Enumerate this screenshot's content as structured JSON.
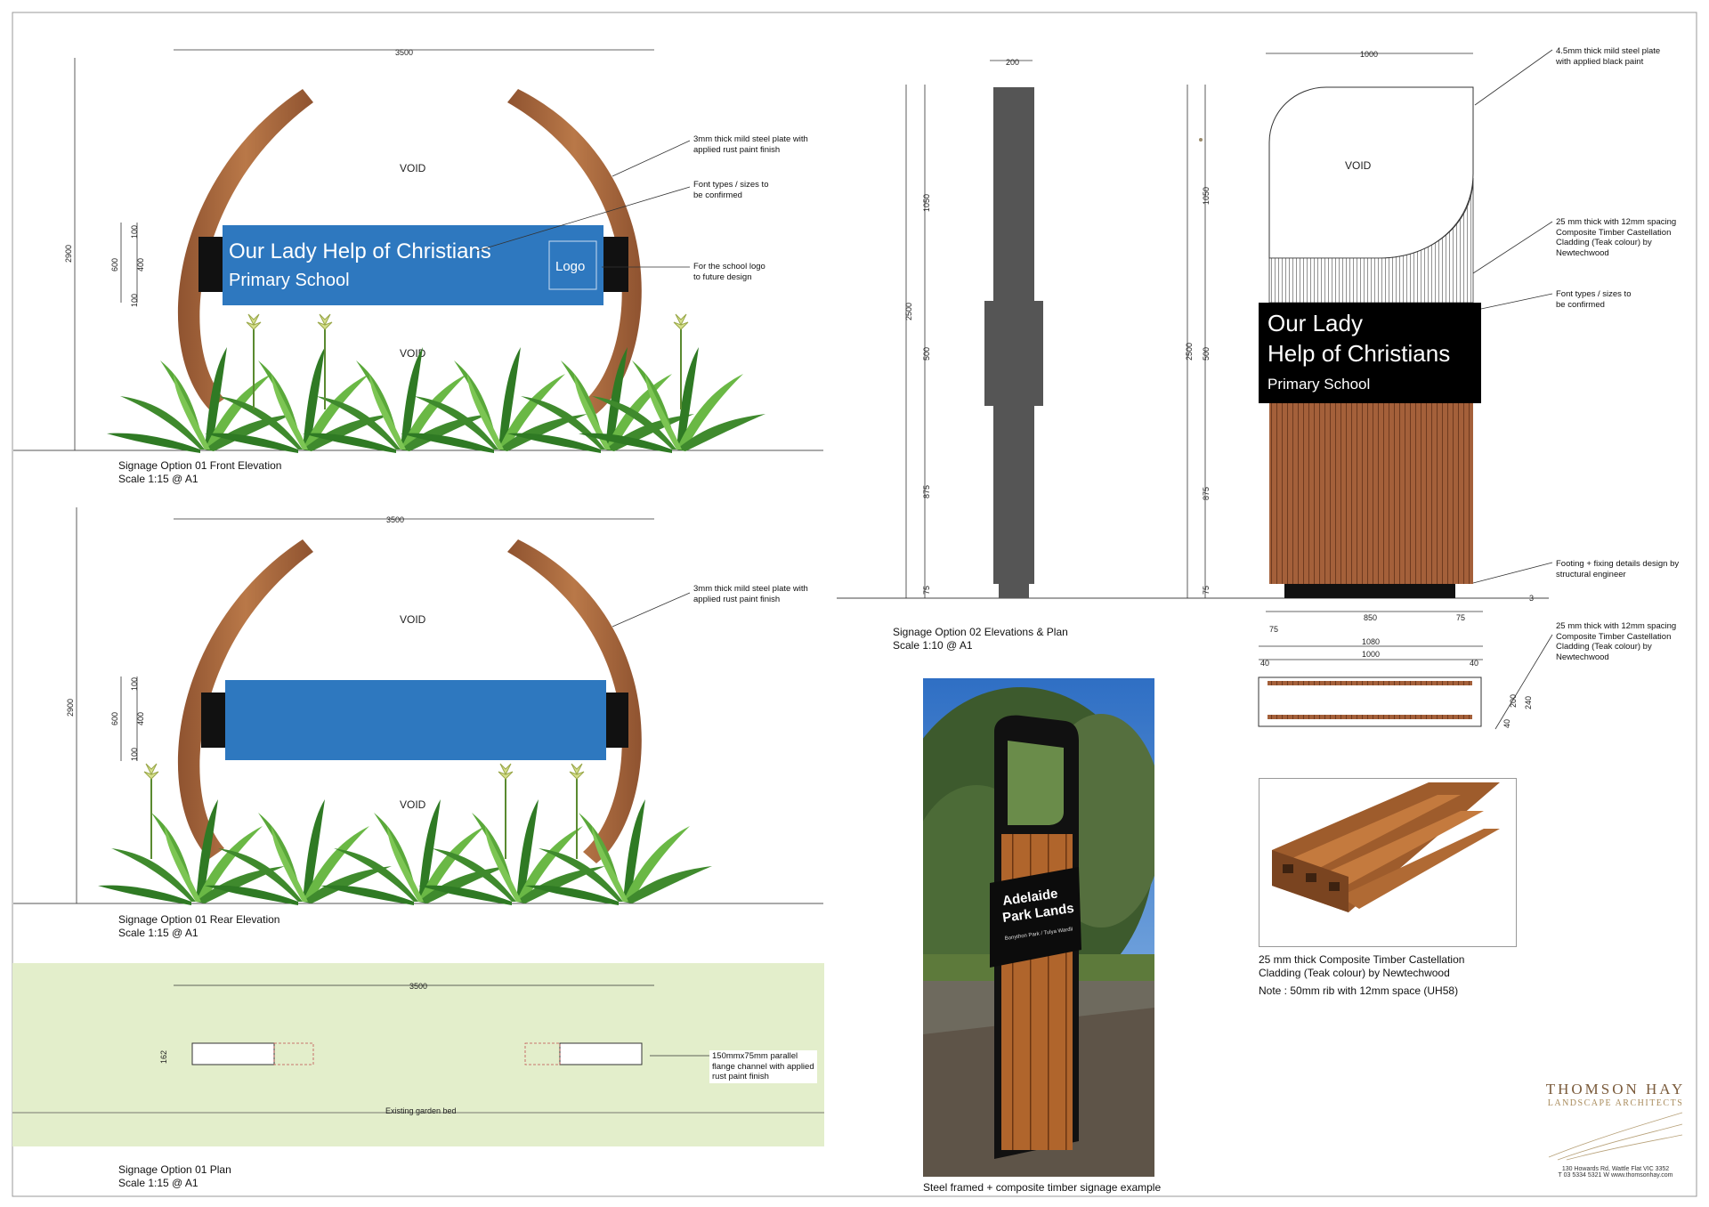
{
  "captions": {
    "opt1_front": [
      "Signage Option 01 Front Elevation",
      "Scale 1:15 @ A1"
    ],
    "opt1_rear": [
      "Signage Option 01 Rear Elevation",
      "Scale 1:15 @ A1"
    ],
    "opt1_plan": [
      "Signage Option 01 Plan",
      "Scale 1:15 @ A1"
    ],
    "opt2": [
      "Signage Option 02 Elevations & Plan",
      "Scale 1:10 @ A1"
    ],
    "photo": "Steel framed + composite timber signage example",
    "swatch": [
      "25 mm thick Composite Timber Castellation",
      "Cladding (Teak colour) by Newtechwood"
    ],
    "swatch_note": "Note : 50mm rib with 12mm space (UH58)"
  },
  "sign1": {
    "line1": "Our Lady Help of Christians",
    "line2": "Primary School",
    "logo": "Logo",
    "void": "VOID"
  },
  "sign2": {
    "line1": "Our Lady",
    "line2": "Help of Christians",
    "line3": "Primary School",
    "void": "VOID"
  },
  "notes": {
    "steel1": [
      "3mm thick mild steel plate with",
      "applied rust paint finish"
    ],
    "fonts": [
      "Font types / sizes to",
      "be confirmed"
    ],
    "logo": [
      "For the school logo",
      "to future design"
    ],
    "steel_rear": [
      "3mm thick mild steel plate with",
      "applied rust paint finish"
    ],
    "channel": [
      "150mmx75mm parallel",
      "flange channel with applied",
      "rust paint finish"
    ],
    "garden": "Existing garden bed",
    "plate2": [
      "4.5mm thick mild steel plate",
      "with applied black paint"
    ],
    "cladding": [
      "25 mm thick with 12mm spacing",
      "Composite Timber Castellation",
      "Cladding (Teak colour) by",
      "Newtechwood"
    ],
    "fonts2": [
      "Font types / sizes to",
      "be confirmed"
    ],
    "footing": [
      "Footing + fixing details design by",
      "structural engineer"
    ],
    "cladding2": [
      "25 mm thick with 12mm spacing",
      "Composite Timber Castellation",
      "Cladding (Teak colour) by",
      "Newtechwood"
    ]
  },
  "dims": {
    "w3500": "3500",
    "h2900": "2900",
    "d600": "600",
    "d400": "400",
    "d100": "100",
    "d200": "200",
    "d1000": "1000",
    "d1050": "1050",
    "d2500": "2500",
    "d500": "500",
    "d875": "875",
    "d75": "75",
    "d850": "850",
    "d1080": "1080",
    "d40": "40",
    "d240": "240",
    "d162": "162",
    "d3": "3"
  },
  "photo_sign": {
    "title1": "Adelaide",
    "title2": "Park Lands",
    "sub": "Bonython Park / Tulya Wardli"
  },
  "firm": {
    "name": "THOMSON HAY",
    "tagline": "LANDSCAPE ARCHITECTS",
    "address": "130 Howards Rd, Wattle Flat VIC 3352",
    "contact": "T 03 5334 5321 W www.thomsonhay.com"
  },
  "colors": {
    "rust": "#a8683f",
    "sign_blue": "#2e78bf",
    "black": "#000000",
    "teak": "#9c5a36",
    "post_grey": "#555555",
    "plan_green": "#e3eecb"
  }
}
